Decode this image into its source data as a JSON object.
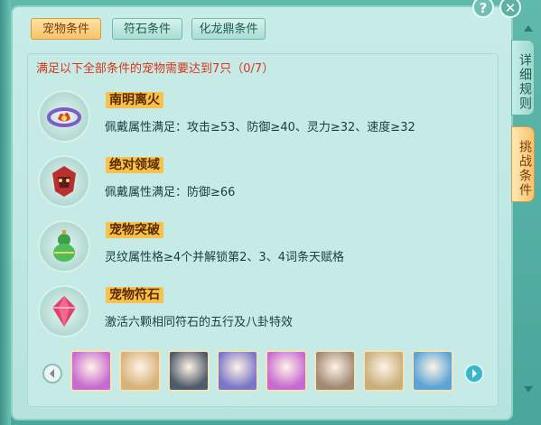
{
  "tabs": [
    {
      "label": "宠物条件",
      "active": true
    },
    {
      "label": "符石条件",
      "active": false
    },
    {
      "label": "化龙鼎条件",
      "active": false
    }
  ],
  "summary": "满足以下全部条件的宠物需要达到7只（0/7）",
  "conditions": [
    {
      "title": "南明离火",
      "desc": "佩戴属性满足：攻击≥53、防御≥40、灵力≥32、速度≥32",
      "icon": "flame-ring-icon"
    },
    {
      "title": "绝对领域",
      "desc": "佩戴属性满足：防御≥66",
      "icon": "demon-shield-icon"
    },
    {
      "title": "宠物突破",
      "desc": "灵纹属性格≥4个并解锁第2、3、4词条天赋格",
      "icon": "gourd-icon"
    },
    {
      "title": "宠物符石",
      "desc": "激活六颗相同符石的五行及八卦特效",
      "icon": "gem-icon"
    }
  ],
  "side_tabs": [
    {
      "label": "详细规则",
      "active": false
    },
    {
      "label": "挑战条件",
      "active": true
    }
  ],
  "top_buttons": {
    "help": "?",
    "close": "✕"
  },
  "pets": [
    {
      "name": "pet-portrait-1",
      "color": "#c76bd0"
    },
    {
      "name": "pet-portrait-2",
      "color": "#d7b27a"
    },
    {
      "name": "pet-portrait-3",
      "color": "#4e5b6a"
    },
    {
      "name": "pet-portrait-4",
      "color": "#7b77c8"
    },
    {
      "name": "pet-portrait-5",
      "color": "#c76bd0"
    },
    {
      "name": "pet-portrait-6",
      "color": "#a08a74"
    },
    {
      "name": "pet-portrait-7",
      "color": "#c9b07a"
    },
    {
      "name": "pet-portrait-8",
      "color": "#5aa4d6"
    }
  ],
  "colors": {
    "accent": "#f7c36a",
    "warning_text": "#d8351c",
    "panel": "#c6ebe6"
  }
}
